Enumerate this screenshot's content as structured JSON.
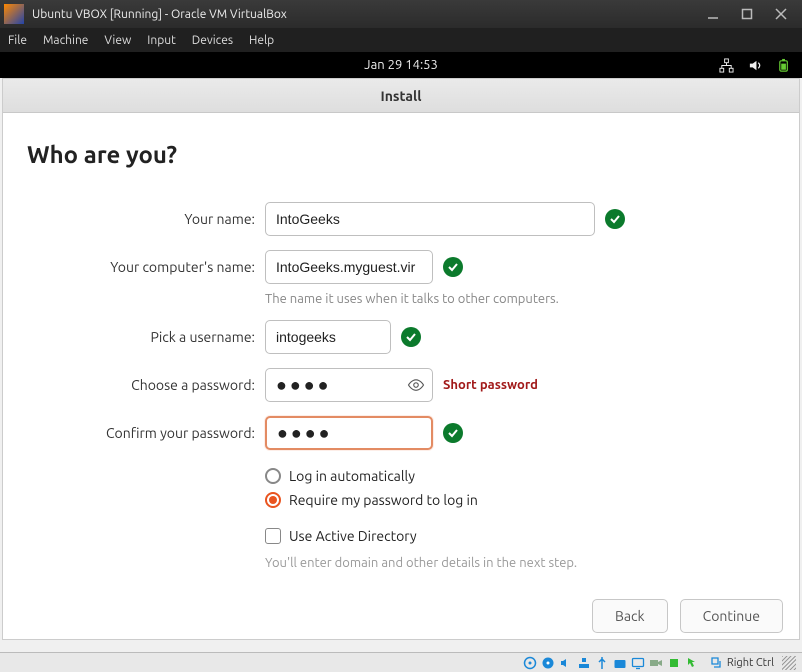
{
  "vbox": {
    "title": "Ubuntu VBOX [Running] - Oracle VM VirtualBox",
    "menu": {
      "file": "File",
      "machine": "Machine",
      "view": "View",
      "input": "Input",
      "devices": "Devices",
      "help": "Help"
    },
    "keyboard_host": "Right Ctrl"
  },
  "ubuntu_bar": {
    "clock": "Jan 29  14:53"
  },
  "install": {
    "title": "Install",
    "heading": "Who are you?",
    "labels": {
      "name": "Your name:",
      "computer": "Your computer's name:",
      "username": "Pick a username:",
      "password": "Choose a password:",
      "confirm": "Confirm your password:"
    },
    "values": {
      "name": "IntoGeeks",
      "computer": "IntoGeeks.myguest.vir",
      "username": "intogeeks",
      "password": "●●●●",
      "confirm": "●●●●"
    },
    "hints": {
      "computer": "The name it uses when it talks to other computers.",
      "short_pw": "Short password",
      "ad": "You'll enter domain and other details in the next step."
    },
    "options": {
      "auto_login": "Log in automatically",
      "require_pw": "Require my password to log in",
      "active_directory": "Use Active Directory"
    },
    "buttons": {
      "back": "Back",
      "continue": "Continue"
    }
  }
}
